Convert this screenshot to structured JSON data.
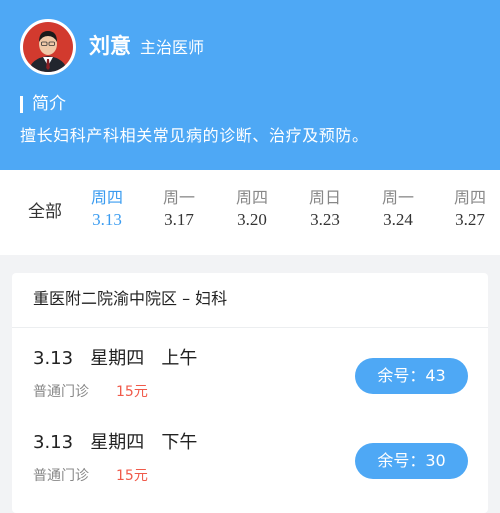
{
  "doctor": {
    "name": "刘意",
    "title": "主治医师",
    "intro_heading": "简介",
    "intro_text": "擅长妇科产科相关常见病的诊断、治疗及预防。"
  },
  "date_tabs": {
    "all_label": "全部",
    "days": [
      {
        "weekday": "周四",
        "date": "3.13",
        "selected": true
      },
      {
        "weekday": "周一",
        "date": "3.17"
      },
      {
        "weekday": "周四",
        "date": "3.20"
      },
      {
        "weekday": "周日",
        "date": "3.23"
      },
      {
        "weekday": "周一",
        "date": "3.24"
      },
      {
        "weekday": "周四",
        "date": "3.27"
      }
    ]
  },
  "schedule": {
    "hospital": "重医附二院渝中院区 – 妇科",
    "slots": [
      {
        "time": "3.13   星期四   上午",
        "type": "普通门诊",
        "price": "15元",
        "remaining": "余号：43"
      },
      {
        "time": "3.13   星期四   下午",
        "type": "普通门诊",
        "price": "15元",
        "remaining": "余号：30"
      }
    ]
  },
  "colors": {
    "header_bg": "#4ea8f5",
    "accent": "#3b9cf0",
    "price": "#f05a4a"
  }
}
